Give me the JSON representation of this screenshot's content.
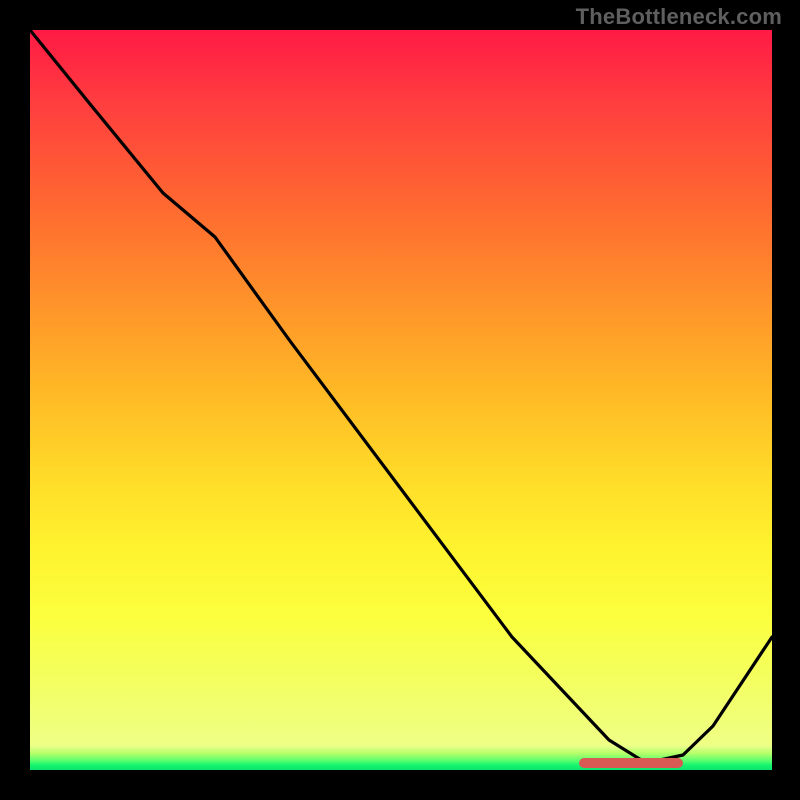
{
  "watermark": "TheBottleneck.com",
  "colors": {
    "background": "#000000",
    "curve": "#000000",
    "marker": "#d95a55",
    "watermark_text": "#5f5f5f"
  },
  "chart_data": {
    "type": "line",
    "title": "",
    "xlabel": "",
    "ylabel": "",
    "xlim": [
      0,
      100
    ],
    "ylim": [
      0,
      100
    ],
    "x": [
      0,
      8,
      18,
      25,
      35,
      50,
      65,
      78,
      83,
      88,
      92,
      100
    ],
    "values": [
      100,
      90,
      78,
      72,
      58,
      38,
      18,
      4,
      1,
      2,
      6,
      18
    ],
    "optimal_range_x": [
      74,
      88
    ],
    "optimal_y": 1,
    "gradient_stops": [
      {
        "pos": 0.0,
        "color": "#ff1a45"
      },
      {
        "pos": 0.5,
        "color": "#ffb726"
      },
      {
        "pos": 0.82,
        "color": "#fbff3e"
      },
      {
        "pos": 0.97,
        "color": "#5dff6f"
      },
      {
        "pos": 1.0,
        "color": "#0be36e"
      }
    ]
  }
}
